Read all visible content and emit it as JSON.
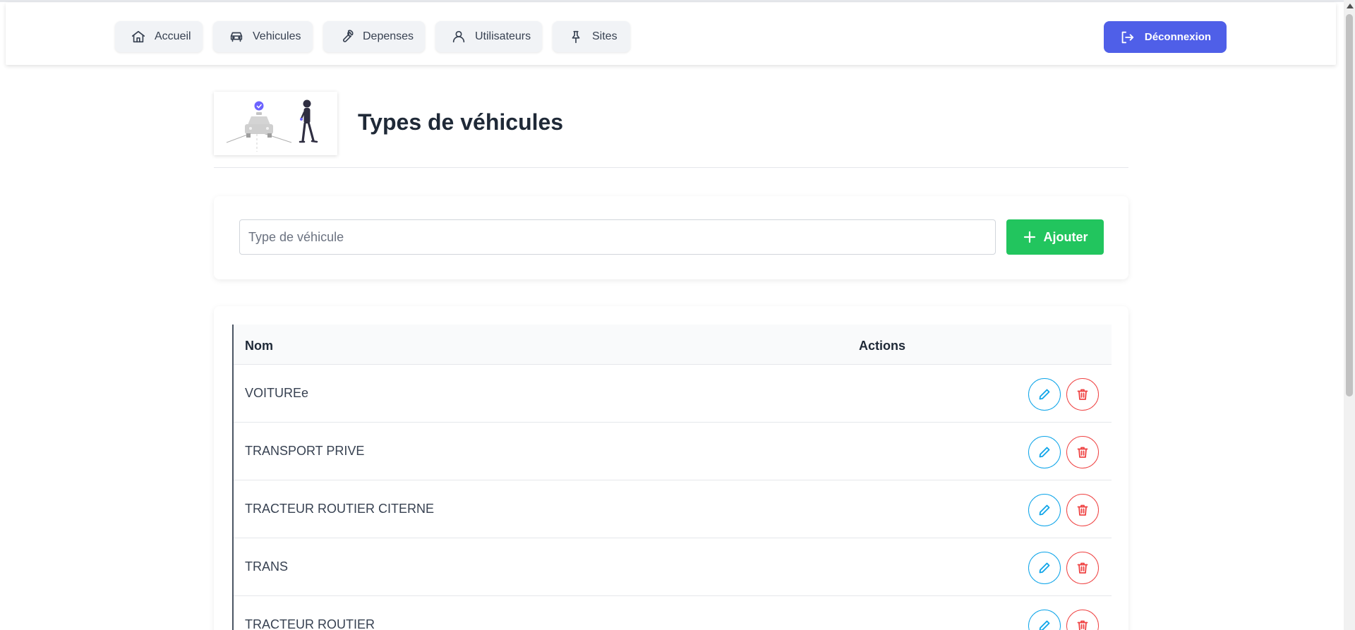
{
  "nav": {
    "items": [
      {
        "label": "Accueil",
        "icon": "home-icon"
      },
      {
        "label": "Vehicules",
        "icon": "car-icon"
      },
      {
        "label": "Depenses",
        "icon": "wrench-icon"
      },
      {
        "label": "Utilisateurs",
        "icon": "user-icon"
      },
      {
        "label": "Sites",
        "icon": "pin-icon"
      }
    ],
    "logout_label": "Déconnexion"
  },
  "page": {
    "title": "Types de véhicules"
  },
  "form": {
    "placeholder": "Type de véhicule",
    "value": "",
    "add_label": "Ajouter"
  },
  "table": {
    "headers": {
      "name": "Nom",
      "actions": "Actions"
    },
    "rows": [
      {
        "name": "VOITUREe"
      },
      {
        "name": "TRANSPORT PRIVE"
      },
      {
        "name": "TRACTEUR ROUTIER CITERNE"
      },
      {
        "name": "TRANS"
      },
      {
        "name": "TRACTEUR ROUTIER"
      }
    ]
  },
  "colors": {
    "accent": "#4f5fe8",
    "add": "#22c55e",
    "edit": "#0ea5e9",
    "delete": "#ef4444",
    "illustration_accent": "#6c63ff"
  }
}
